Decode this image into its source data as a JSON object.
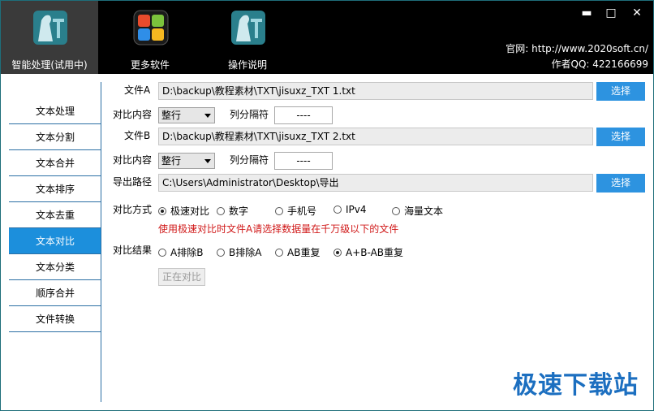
{
  "toolbar": {
    "items": [
      {
        "label": "智能处理(试用中)",
        "icon": "statue-t-icon"
      },
      {
        "label": "更多软件",
        "icon": "windows-tiles-icon"
      },
      {
        "label": "操作说明",
        "icon": "statue-t-icon"
      }
    ]
  },
  "window": {
    "minimize": "▬",
    "maximize": "□",
    "close": "✕"
  },
  "info": {
    "website": "官网: http://www.2020soft.cn/",
    "qq": "作者QQ: 422166699"
  },
  "sidebar": {
    "items": [
      "文本处理",
      "文本分割",
      "文本合并",
      "文本排序",
      "文本去重",
      "文本对比",
      "文本分类",
      "顺序合并",
      "文件转换"
    ],
    "active_index": 5
  },
  "form": {
    "file_a_label": "文件A",
    "file_a_path": "D:\\backup\\教程素材\\TXT\\jisuxz_TXT 1.txt",
    "compare_content_label": "对比内容",
    "compare_content_value": "整行",
    "column_sep_label": "列分隔符",
    "column_sep_value": "----",
    "file_b_label": "文件B",
    "file_b_path": "D:\\backup\\教程素材\\TXT\\jisuxz_TXT 2.txt",
    "compare_content_b_value": "整行",
    "column_sep_b_value": "----",
    "export_label": "导出路径",
    "export_path": "C:\\Users\\Administrator\\Desktop\\导出",
    "select_label": "选择",
    "method_label": "对比方式",
    "methods": [
      "极速对比",
      "数字",
      "手机号",
      "IPv4",
      "海量文本"
    ],
    "method_selected": 0,
    "hint": "使用极速对比时文件A请选择数据量在千万级以下的文件",
    "result_label": "对比结果",
    "results": [
      "A排除B",
      "B排除A",
      "AB重复",
      "A+B-AB重复"
    ],
    "result_selected": 3,
    "run_button": "正在对比"
  },
  "watermark": "极速下载站"
}
